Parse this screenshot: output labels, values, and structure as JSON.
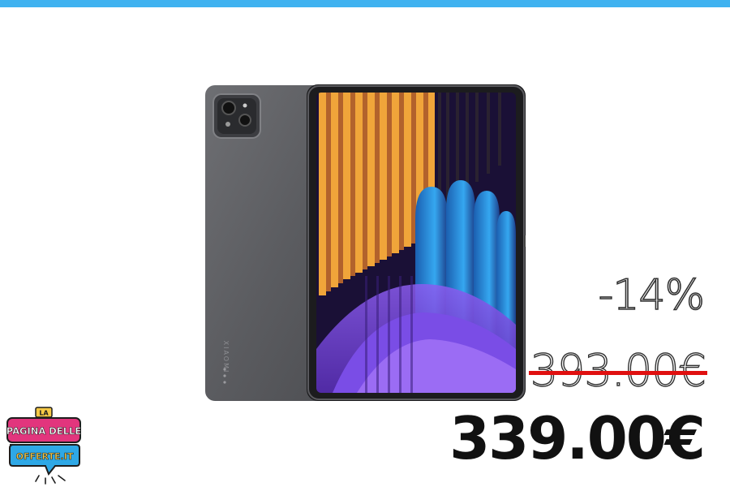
{
  "header": {
    "accent_color": "#3fb2f0"
  },
  "product": {
    "image": "tablet-product-image",
    "brand_print": "XIAOMI"
  },
  "pricing": {
    "discount": "-14%",
    "old_price": "393.00€",
    "new_price": "339.00€",
    "strike_color": "#e01010"
  },
  "logo": {
    "line1": "LA",
    "line2": "PAGINA DELLE",
    "line3": "OFFERTE.IT"
  }
}
